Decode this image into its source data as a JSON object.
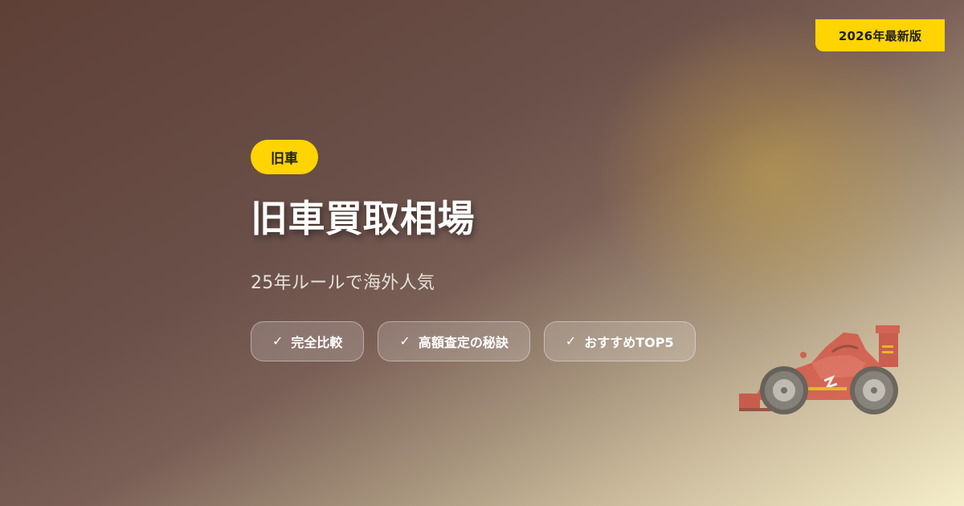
{
  "badge": {
    "text": "2026年最新版"
  },
  "category": {
    "label": "旧車"
  },
  "title": "旧車買取相場",
  "subtitle": "25年ルールで海外人気",
  "tags": [
    {
      "label": "完全比較"
    },
    {
      "label": "高額査定の秘訣"
    },
    {
      "label": "おすすめTOP5"
    }
  ],
  "tag_check_glyph": "✓",
  "colors": {
    "accent": "#ffd400",
    "background_dark": "#5e4037",
    "background_light": "#f5edca",
    "car_red": "#d6453a"
  },
  "illustration": {
    "icon": "race-car-icon"
  }
}
